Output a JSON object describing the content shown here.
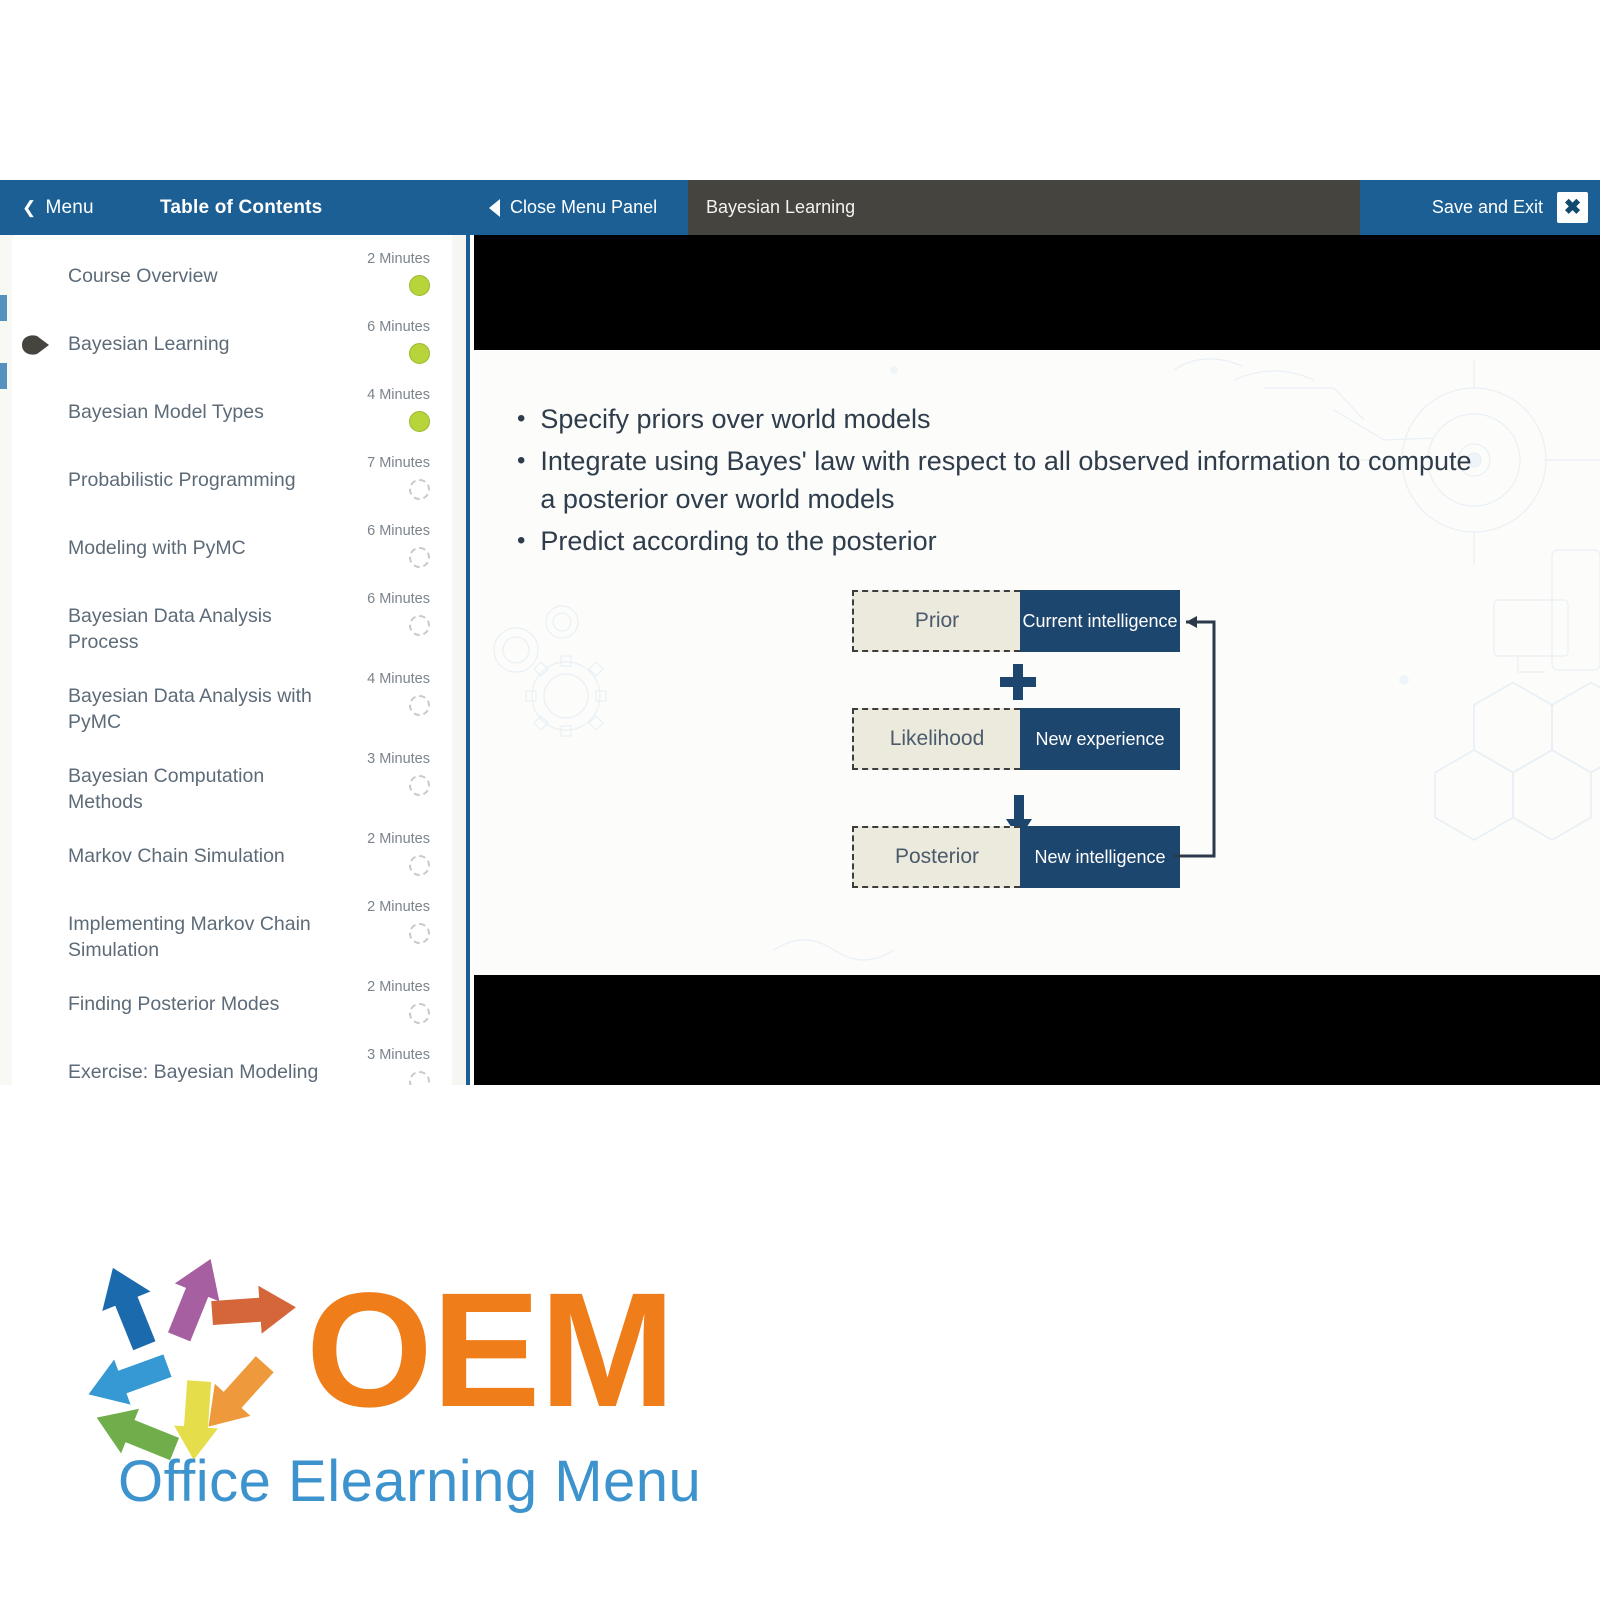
{
  "header": {
    "menu_label": "Menu",
    "menu_icon": "chevron-left-icon",
    "toc_title": "Table of Contents",
    "close_panel_label": "Close Menu Panel",
    "close_panel_icon": "triangle-left-icon",
    "lesson_title": "Bayesian Learning",
    "save_exit_label": "Save and Exit",
    "close_icon_glyph": "✖"
  },
  "colors": {
    "header_blue": "#1b5f94",
    "title_bar_grey": "#46443f",
    "accent_orange": "#ef7d1a",
    "logo_blue": "#3d93cd",
    "status_complete_green": "#b7d43a",
    "diagram_navy": "#1d466f",
    "diagram_beige": "#ece9dd"
  },
  "toc": {
    "items": [
      {
        "label": "Course Overview",
        "time": "2 Minutes",
        "status": "complete",
        "current": false
      },
      {
        "label": "Bayesian Learning",
        "time": "6 Minutes",
        "status": "complete",
        "current": true
      },
      {
        "label": "Bayesian Model Types",
        "time": "4 Minutes",
        "status": "complete",
        "current": false
      },
      {
        "label": "Probabilistic Programming",
        "time": "7 Minutes",
        "status": "incomplete",
        "current": false
      },
      {
        "label": "Modeling with PyMC",
        "time": "6 Minutes",
        "status": "incomplete",
        "current": false
      },
      {
        "label": "Bayesian Data Analysis Process",
        "time": "6 Minutes",
        "status": "incomplete",
        "current": false
      },
      {
        "label": "Bayesian Data Analysis with PyMC",
        "time": "4 Minutes",
        "status": "incomplete",
        "current": false
      },
      {
        "label": "Bayesian Computation Methods",
        "time": "3 Minutes",
        "status": "incomplete",
        "current": false
      },
      {
        "label": "Markov Chain Simulation",
        "time": "2 Minutes",
        "status": "incomplete",
        "current": false
      },
      {
        "label": "Implementing Markov Chain Simulation",
        "time": "2 Minutes",
        "status": "incomplete",
        "current": false
      },
      {
        "label": "Finding Posterior Modes",
        "time": "2 Minutes",
        "status": "incomplete",
        "current": false
      },
      {
        "label": "Exercise: Bayesian Modeling with PyMC",
        "time": "3 Minutes",
        "status": "incomplete",
        "current": false
      }
    ]
  },
  "slide": {
    "bullets": [
      "Specify priors over world models",
      "Integrate using Bayes' law with respect to all observed information to compute a posterior over world models",
      "Predict according to the posterior"
    ],
    "diagram": {
      "rows": [
        {
          "term": "Prior",
          "meaning": "Current intelligence"
        },
        {
          "term": "Likelihood",
          "meaning": "New experience"
        },
        {
          "term": "Posterior",
          "meaning": "New intelligence"
        }
      ],
      "operator_icon": "plus-icon",
      "flow_icon": "down-arrow-icon",
      "feedback_icon": "feedback-loop-arrow-icon"
    }
  },
  "logo": {
    "wordmark": "OEM",
    "tagline": "Office Elearning Menu",
    "arrows_icon": "circular-arrows-icon",
    "arrow_colors": [
      "#1b6aae",
      "#a65fa0",
      "#d4663a",
      "#3699d3",
      "#ee9a3c",
      "#6fae4b",
      "#e5de4a"
    ]
  }
}
